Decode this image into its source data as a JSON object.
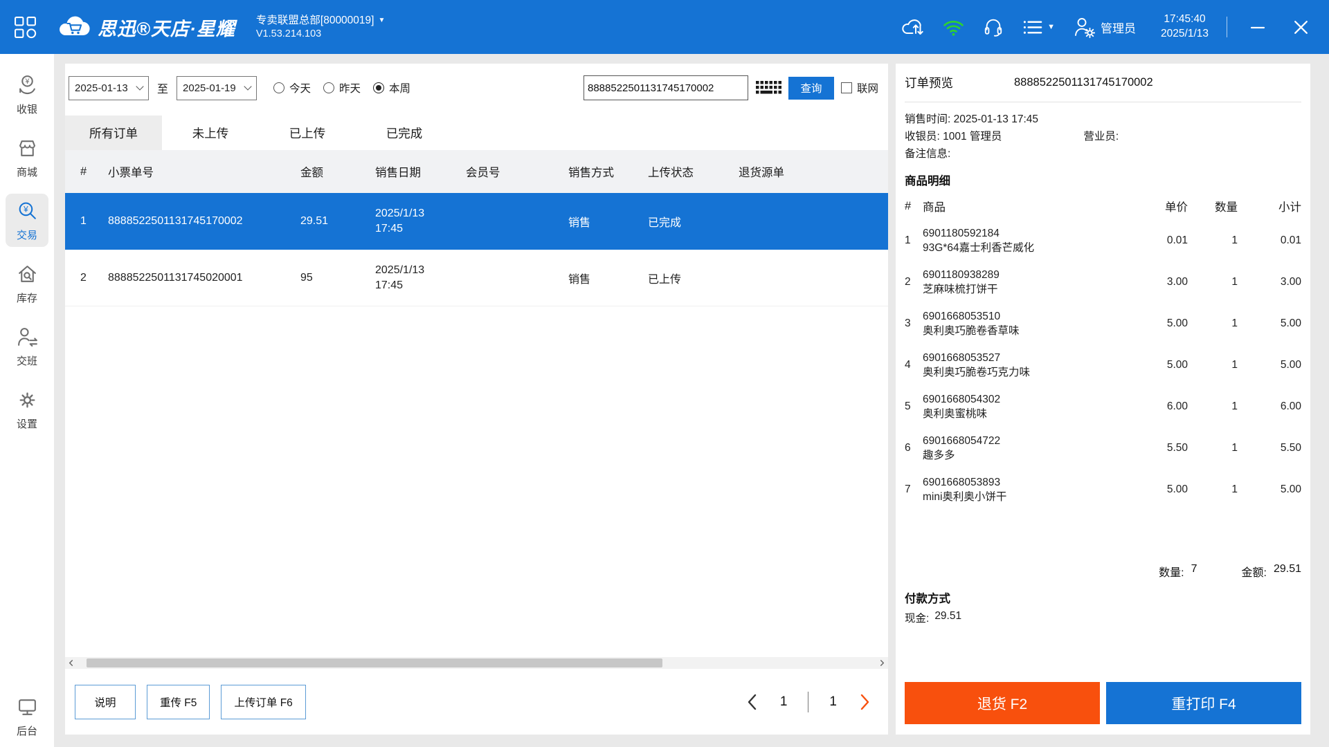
{
  "colors": {
    "accent": "#1573D4",
    "orange": "#F8500D",
    "green": "#2ED32E",
    "bg": "#E9E9E9",
    "header_gray": "#F1F2F4"
  },
  "topbar": {
    "brand": "思迅®天店·星耀",
    "store_name": "专卖联盟总部[80000019]",
    "store_caret": "▼",
    "version": "V1.53.214.103",
    "user": "管理员",
    "time": "17:45:40",
    "date": "2025/1/13",
    "minimize": "—",
    "close": "✕"
  },
  "sidebar": {
    "items": [
      {
        "label": "收银",
        "icon": "cash-hand"
      },
      {
        "label": "商城",
        "icon": "storefront"
      },
      {
        "label": "交易",
        "icon": "search-yen",
        "active": true
      },
      {
        "label": "库存",
        "icon": "house-search"
      },
      {
        "label": "交班",
        "icon": "shift-person"
      },
      {
        "label": "设置",
        "icon": "gear"
      }
    ],
    "bottom": {
      "label": "后台",
      "icon": "monitor"
    }
  },
  "filters": {
    "date_from": "2025-01-13",
    "to_label": "至",
    "date_to": "2025-01-19",
    "radios": [
      {
        "label": "今天",
        "checked": false
      },
      {
        "label": "昨天",
        "checked": false
      },
      {
        "label": "本周",
        "checked": true
      }
    ],
    "search_value": "8888522501131745170002",
    "query_button": "查询",
    "online_label": "联网",
    "online_checked": false
  },
  "tabs": [
    {
      "label": "所有订单",
      "active": true
    },
    {
      "label": "未上传",
      "active": false
    },
    {
      "label": "已上传",
      "active": false
    },
    {
      "label": "已完成",
      "active": false
    }
  ],
  "orders": {
    "headers": [
      "#",
      "小票单号",
      "金额",
      "销售日期",
      "会员号",
      "销售方式",
      "上传状态",
      "退货源单"
    ],
    "rows": [
      {
        "idx": "1",
        "receipt_no": "8888522501131745170002",
        "amount": "29.51",
        "date1": "2025/1/13",
        "date2": "17:45",
        "member": "",
        "method": "销售",
        "status": "已完成",
        "refund_source": "",
        "selected": true
      },
      {
        "idx": "2",
        "receipt_no": "8888522501131745020001",
        "amount": "95",
        "date1": "2025/1/13",
        "date2": "17:45",
        "member": "",
        "method": "销售",
        "status": "已上传",
        "refund_source": "",
        "selected": false
      }
    ]
  },
  "footer": {
    "buttons": [
      "说明",
      "重传 F5",
      "上传订单 F6"
    ],
    "pagination": {
      "current": "1",
      "total": "1"
    }
  },
  "preview": {
    "title": "订单预览",
    "order_no": "8888522501131745170002",
    "sale_time_label": "销售时间:",
    "sale_time": "2025-01-13 17:45",
    "cashier_label": "收银员:",
    "cashier": "1001 管理员",
    "clerk_label": "营业员:",
    "clerk": "",
    "remark_label": "备注信息:",
    "remark": "",
    "detail_title": "商品明细",
    "item_headers": [
      "#",
      "商品",
      "单价",
      "数量",
      "小计"
    ],
    "items": [
      {
        "idx": "1",
        "code": "6901180592184",
        "name": "93G*64嘉士利香芒威化",
        "price": "0.01",
        "qty": "1",
        "subtotal": "0.01"
      },
      {
        "idx": "2",
        "code": "6901180938289",
        "name": "芝麻味梳打饼干",
        "price": "3.00",
        "qty": "1",
        "subtotal": "3.00"
      },
      {
        "idx": "3",
        "code": "6901668053510",
        "name": "奥利奥巧脆卷香草味",
        "price": "5.00",
        "qty": "1",
        "subtotal": "5.00"
      },
      {
        "idx": "4",
        "code": "6901668053527",
        "name": "奥利奥巧脆卷巧克力味",
        "price": "5.00",
        "qty": "1",
        "subtotal": "5.00"
      },
      {
        "idx": "5",
        "code": "6901668054302",
        "name": "奥利奥蜜桃味",
        "price": "6.00",
        "qty": "1",
        "subtotal": "6.00"
      },
      {
        "idx": "6",
        "code": "6901668054722",
        "name": "趣多多",
        "price": "5.50",
        "qty": "1",
        "subtotal": "5.50"
      },
      {
        "idx": "7",
        "code": "6901668053893",
        "name": "mini奥利奥小饼干",
        "price": "5.00",
        "qty": "1",
        "subtotal": "5.00"
      }
    ],
    "summary": {
      "qty_label": "数量:",
      "qty": "7",
      "amount_label": "金额:",
      "amount": "29.51"
    },
    "payment_title": "付款方式",
    "payment_method": "现金:",
    "payment_amount": "29.51",
    "refund_button": "退货 F2",
    "reprint_button": "重打印 F4"
  }
}
